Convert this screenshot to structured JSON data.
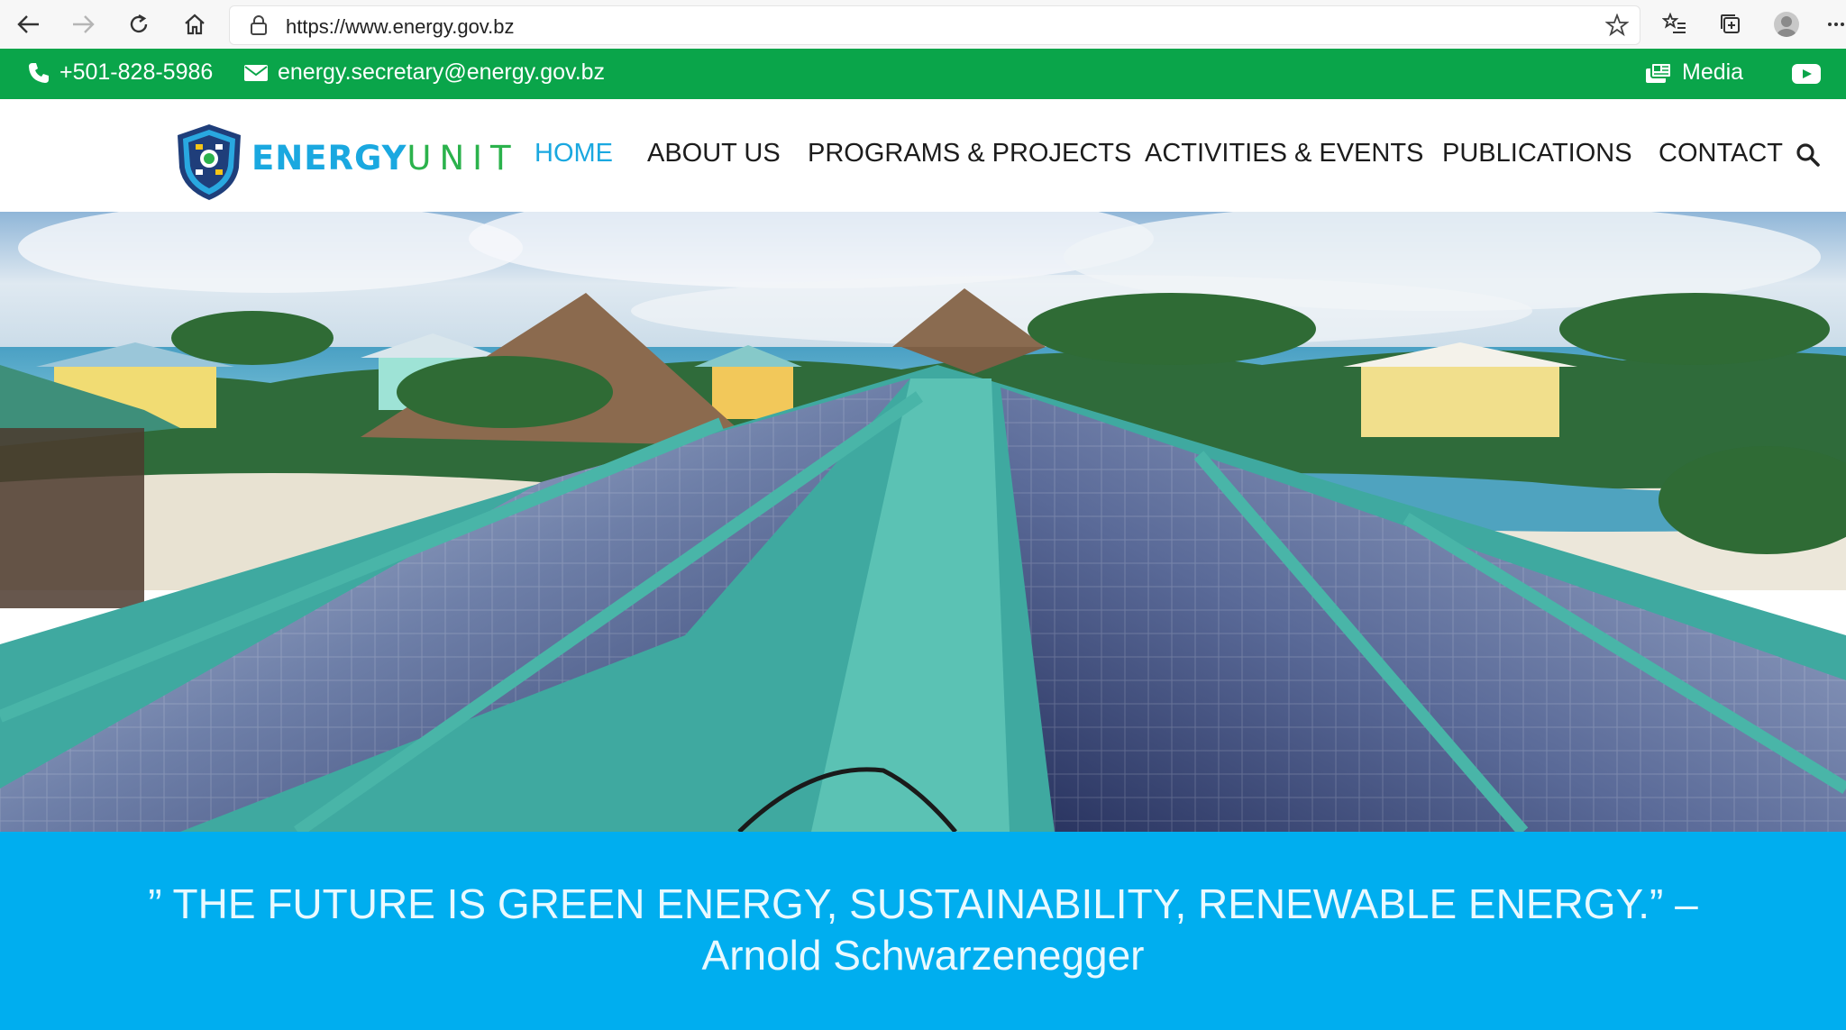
{
  "browser": {
    "url": "https://www.energy.gov.bz"
  },
  "topbar": {
    "phone": "+501-828-5986",
    "email": "energy.secretary@energy.gov.bz",
    "media_label": "Media",
    "bg_color": "#0aa54a"
  },
  "header": {
    "logo_energy": "ENERGY",
    "logo_unit": "UNIT",
    "nav": [
      {
        "label": "HOME",
        "active": true
      },
      {
        "label": "ABOUT US"
      },
      {
        "label": "PROGRAMS & PROJECTS"
      },
      {
        "label": "ACTIVITIES & EVENTS"
      },
      {
        "label": "PUBLICATIONS"
      },
      {
        "label": "CONTACT"
      }
    ],
    "accent_color": "#1aa8e0"
  },
  "quote": {
    "text": "” THE FUTURE IS GREEN ENERGY, SUSTAINABILITY, RENEWABLE ENERGY.” – Arnold Schwarzenegger",
    "bg_color": "#00aeef"
  }
}
